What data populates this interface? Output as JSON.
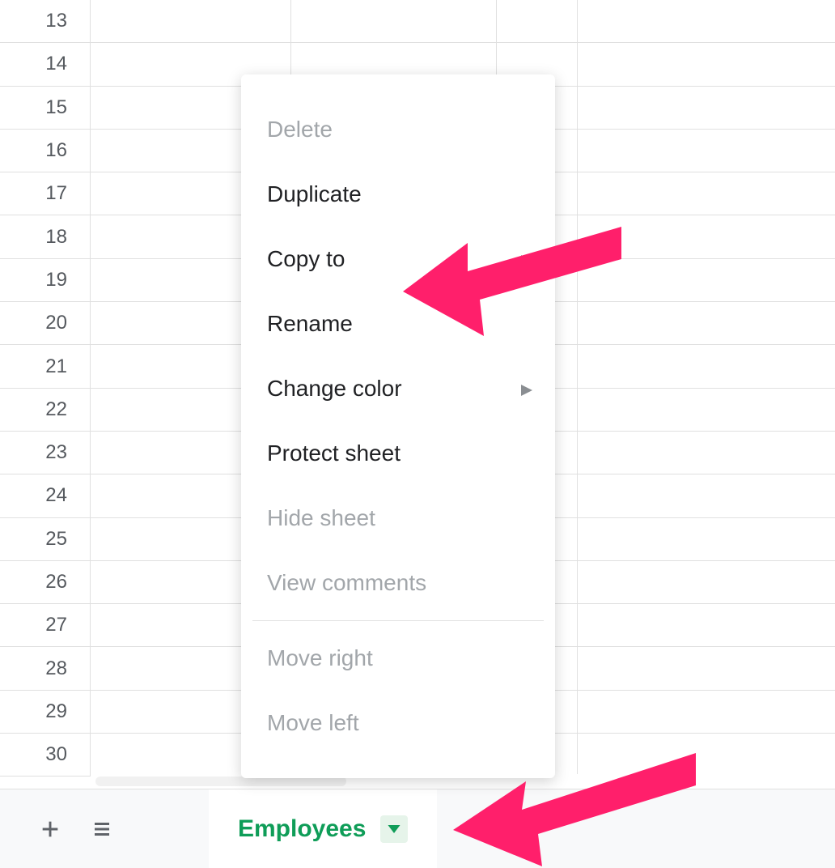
{
  "rows": [
    "13",
    "14",
    "15",
    "16",
    "17",
    "18",
    "19",
    "20",
    "21",
    "22",
    "23",
    "24",
    "25",
    "26",
    "27",
    "28",
    "29",
    "30"
  ],
  "menu": {
    "delete": "Delete",
    "duplicate": "Duplicate",
    "copy_to": "Copy to",
    "rename": "Rename",
    "change_color": "Change color",
    "protect_sheet": "Protect sheet",
    "hide_sheet": "Hide sheet",
    "view_comments": "View comments",
    "move_right": "Move right",
    "move_left": "Move left"
  },
  "tabbar": {
    "active_tab": "Employees"
  },
  "colors": {
    "accent": "#0f9d58",
    "annotation": "#ff1f6b"
  }
}
